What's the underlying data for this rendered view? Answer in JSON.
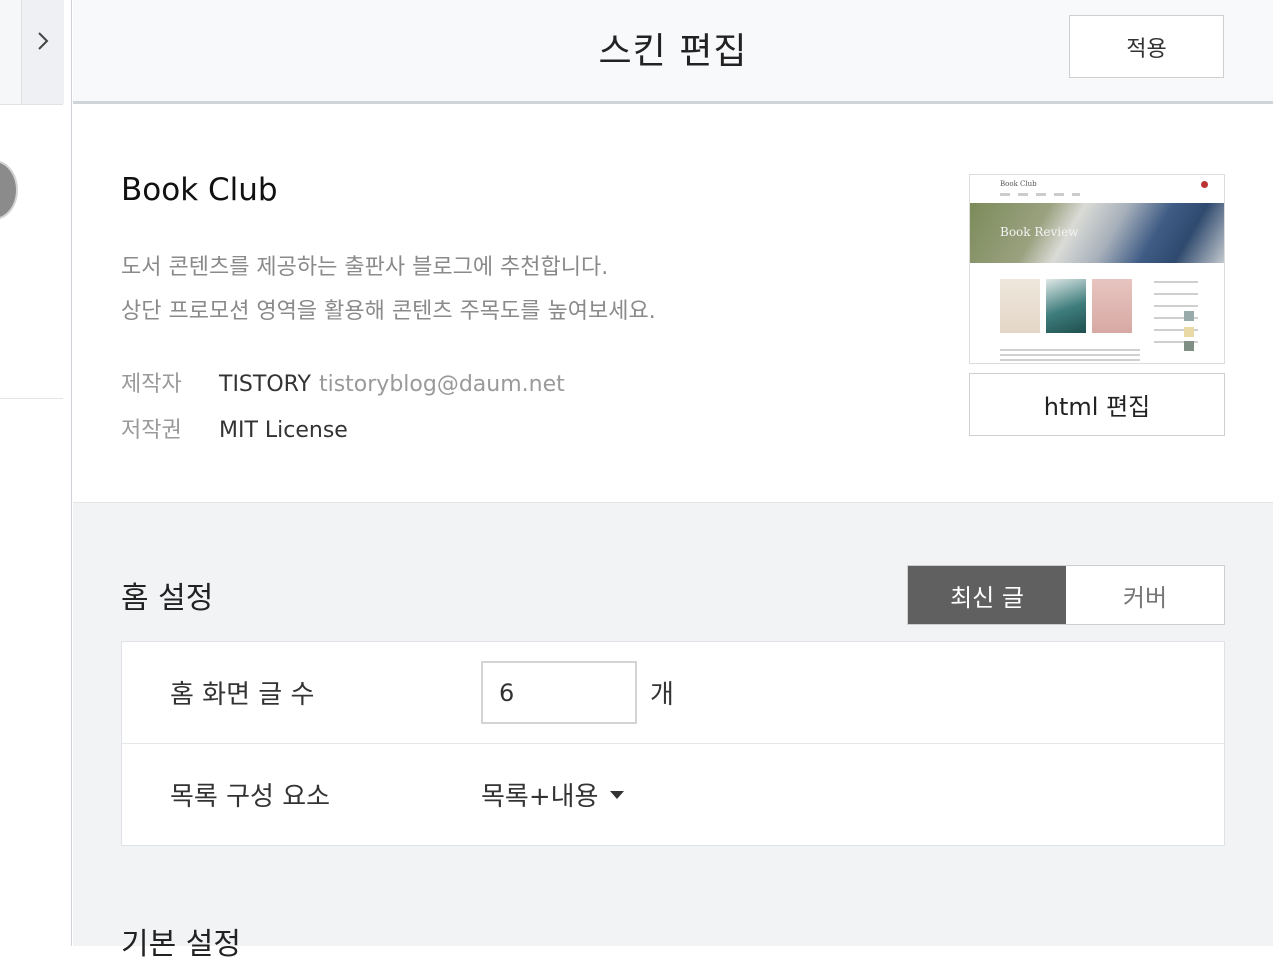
{
  "header": {
    "title": "스킨 편집",
    "apply_label": "적용"
  },
  "skin": {
    "name": "Book Club",
    "description_lines": [
      "도서 콘텐츠를 제공하는 출판사 블로그에 추천합니다.",
      "상단 프로모션 영역을 활용해 콘텐츠 주목도를 높여보세요."
    ],
    "author_label": "제작자",
    "author_name": "TISTORY",
    "author_email": "tistoryblog@daum.net",
    "license_label": "저작권",
    "license_value": "MIT License",
    "preview": {
      "logo": "Book Club",
      "hero_text": "Book Review"
    },
    "html_edit_label": "html 편집"
  },
  "home_settings": {
    "title": "홈 설정",
    "toggle_options": [
      {
        "label": "최신 글",
        "active": true
      },
      {
        "label": "커버",
        "active": false
      }
    ],
    "post_count_label": "홈 화면 글 수",
    "post_count_value": "6",
    "post_count_unit": "개",
    "list_component_label": "목록 구성 요소",
    "list_component_value": "목록+내용"
  },
  "basic_settings": {
    "title": "기본 설정"
  },
  "colors": {
    "toggle_active": "#606060",
    "panel_bg": "#f2f3f5",
    "header_bg": "#f8f9fa"
  },
  "icons": {
    "expand": "chevron-right-icon",
    "dropdown": "caret-down-icon"
  }
}
